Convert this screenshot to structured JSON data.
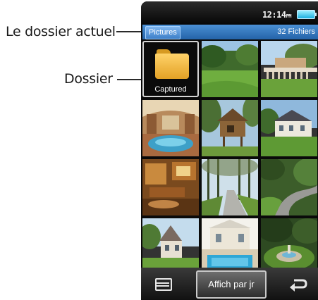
{
  "callouts": {
    "current_folder": "Le dossier actuel",
    "folder": "Dossier"
  },
  "status": {
    "time": "12:14",
    "ampm": "PM",
    "battery": "battery-full-icon"
  },
  "path_bar": {
    "path": "Pictures",
    "count": "32 Fichiers"
  },
  "grid": {
    "folder": {
      "label": "Captured",
      "icon": "folder-icon"
    },
    "thumbnails": [
      "garden-lawn-thumbnail",
      "terrace-balustrade-thumbnail",
      "indoor-pool-thumbnail",
      "wooden-treehouse-thumbnail",
      "white-mansion-thumbnail",
      "wood-paneled-room-thumbnail",
      "forest-driveway-thumbnail",
      "curving-road-thumbnail",
      "tudor-house-thumbnail",
      "pool-house-thumbnail",
      "fountain-garden-thumbnail"
    ]
  },
  "bottom_bar": {
    "menu_icon": "menu-icon",
    "view_by_day": "Affich par jr",
    "back_icon": "back-arrow-icon"
  },
  "colors": {
    "path_bar": "#2f73bd",
    "folder": "#f0b43a",
    "screen_bg": "#0a0a0a"
  }
}
